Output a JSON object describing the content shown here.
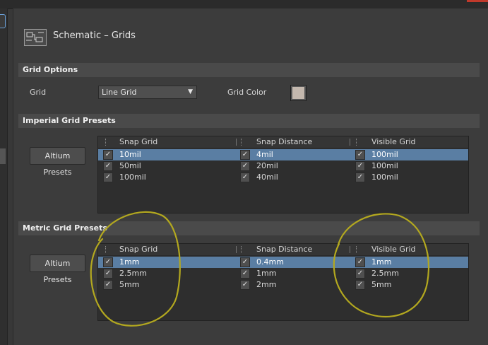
{
  "page": {
    "title": "Schematic – Grids"
  },
  "grid_options": {
    "header": "Grid Options",
    "grid_label": "Grid",
    "grid_value": "Line Grid",
    "grid_color_label": "Grid Color",
    "grid_color": "#c4b8ae"
  },
  "imperial": {
    "header": "Imperial Grid Presets",
    "button": "Altium Presets",
    "columns": [
      "Snap Grid",
      "Snap Distance",
      "Visible Grid"
    ],
    "rows": [
      [
        "10mil",
        "4mil",
        "100mil"
      ],
      [
        "50mil",
        "20mil",
        "100mil"
      ],
      [
        "100mil",
        "40mil",
        "100mil"
      ]
    ]
  },
  "metric": {
    "header": "Metric Grid Presets",
    "button": "Altium Presets",
    "columns": [
      "Snap Grid",
      "Snap Distance",
      "Visible Grid"
    ],
    "rows": [
      [
        "1mm",
        "0.4mm",
        "1mm"
      ],
      [
        "2.5mm",
        "1mm",
        "2.5mm"
      ],
      [
        "5mm",
        "2mm",
        "5mm"
      ]
    ]
  },
  "colors": {
    "selected_row": "#5a7ea3",
    "annotation": "#b3a81f"
  }
}
